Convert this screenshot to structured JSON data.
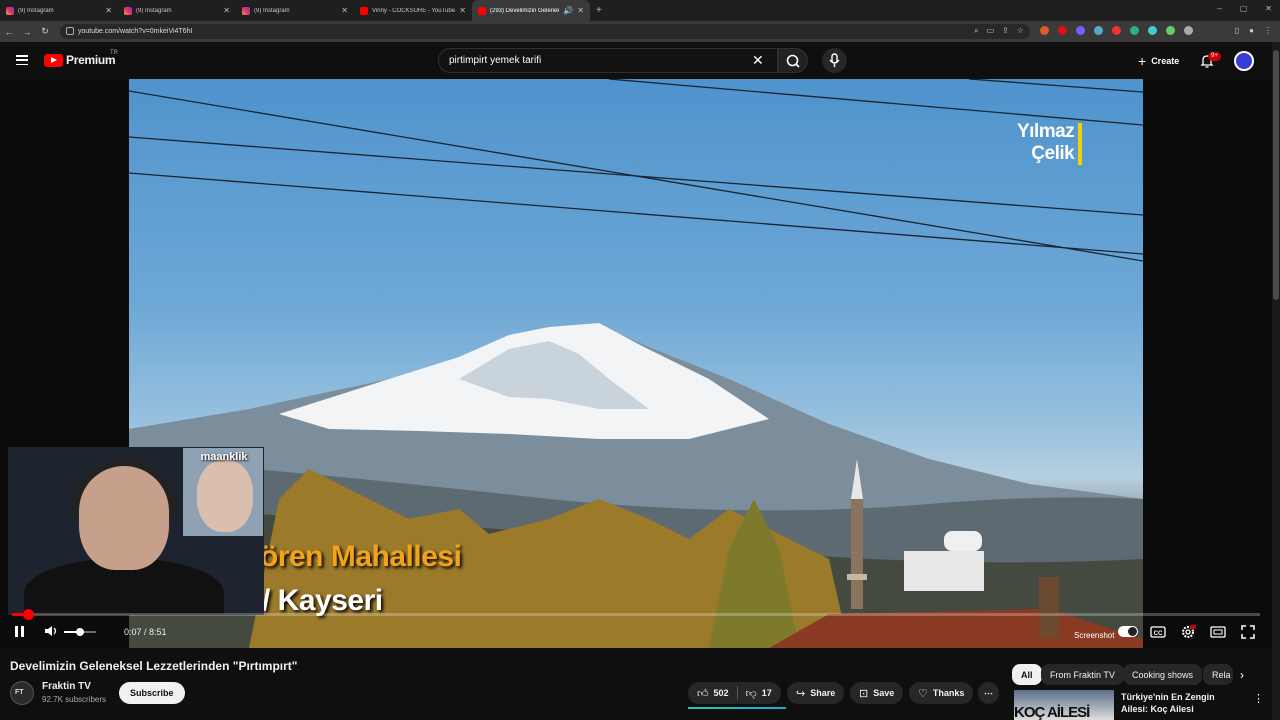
{
  "browser": {
    "tabs": [
      {
        "title": "(9) Instagram",
        "icon": "instagram-icon",
        "active": false
      },
      {
        "title": "(9) Instagram",
        "icon": "instagram-icon",
        "active": false
      },
      {
        "title": "(9) Instagram",
        "icon": "instagram-icon",
        "active": false
      },
      {
        "title": "Vinny - COCKSURE - YouTube",
        "icon": "youtube-icon",
        "active": false
      },
      {
        "title": "(293) Develimizin Geleneks",
        "icon": "youtube-icon",
        "active": true
      }
    ],
    "url": "youtube.com/watch?v=0mkeiVi4T6hI"
  },
  "masthead": {
    "logo_text": "Premium",
    "logo_sup": "TR",
    "search_value": "pirtimpirt yemek tarifi",
    "create_label": "Create",
    "notifications_badge": "9+"
  },
  "video": {
    "watermark_line1": "Yılmaz",
    "watermark_line2": "Çelik",
    "caption_line1": "ören Mahallesi",
    "caption_line2": "/ Kayseri",
    "webcam_inset_label": "maanklik",
    "current_time": "0:07",
    "duration": "8:51",
    "time_display": "0:07 / 8:51",
    "progress_fraction": 0.013,
    "volume_fraction": 0.5,
    "screenshot_label": "Screenshot"
  },
  "watch": {
    "title": "Develimizin Geleneksel Lezzetlerinden \"Pırtımpırt\"",
    "channel_name": "Fraktin TV",
    "subscribers": "92.7K subscribers",
    "subscribe_label": "Subscribe",
    "likes": "502",
    "dislikes": "17",
    "share_label": "Share",
    "save_label": "Save",
    "thanks_label": "Thanks"
  },
  "chips": [
    "All",
    "From Fraktin TV",
    "Cooking shows",
    "Rela"
  ],
  "recommendation": {
    "title": "Türkiye'nin En Zengin Ailesi: Koç Ailesi",
    "thumb_text": "KOÇ AİLESİ"
  },
  "colors": {
    "accent": "#ff0000",
    "caption_orange": "#f3a21b",
    "watermark_bar": "#f5d000"
  }
}
